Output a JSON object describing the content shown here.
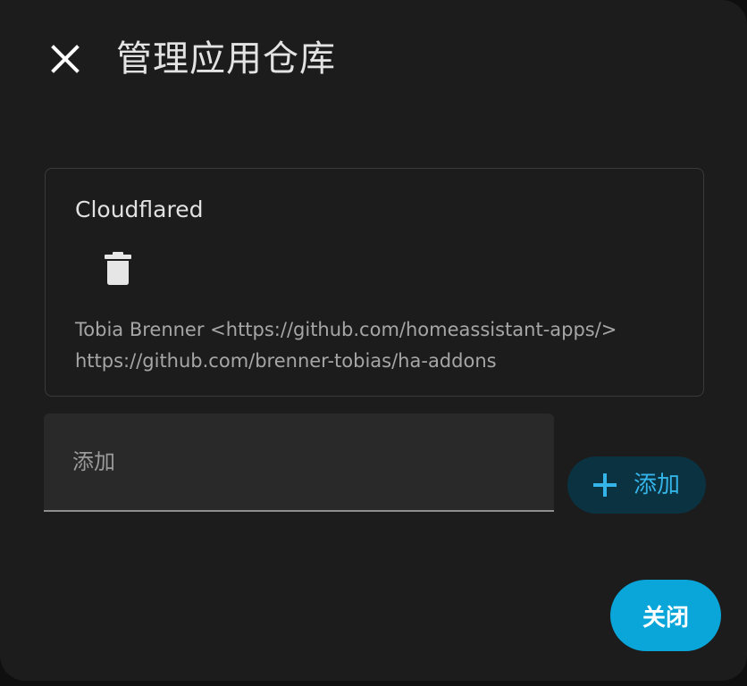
{
  "dialog": {
    "title": "管理应用仓库"
  },
  "repository": {
    "name": "Cloudflared",
    "maintainer": "Tobia Brenner <https://github.com/homeassistant-apps/>",
    "url": "https://github.com/brenner-tobias/ha-addons"
  },
  "add_repository": {
    "placeholder": "添加",
    "value": "",
    "button_label": "添加"
  },
  "footer": {
    "close_label": "关闭"
  },
  "colors": {
    "background": "#1c1c1c",
    "accent": "#0aa5d9",
    "add_button_bg": "#0b3241",
    "add_button_text": "#34b4e8"
  },
  "icons": {
    "close": "close-icon",
    "delete": "trash-icon",
    "add": "plus-icon"
  }
}
